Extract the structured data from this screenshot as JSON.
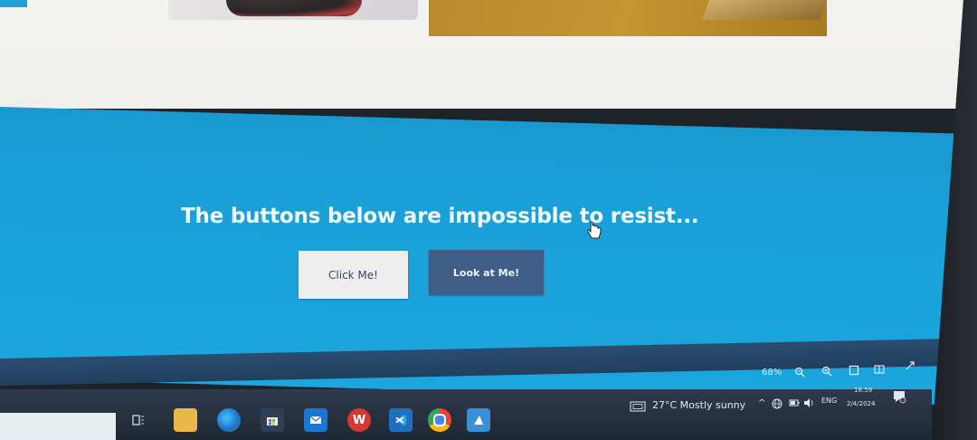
{
  "page": {
    "headline": "The buttons below are impossible to resist...",
    "buttons": [
      {
        "label": "Click Me!"
      },
      {
        "label": "Look at Me!"
      }
    ]
  },
  "statusbar": {
    "zoom": "68%"
  },
  "taskbar": {
    "weather": "27°C  Mostly sunny",
    "language": "ENG",
    "time": "18:59",
    "date": "2/4/2024"
  },
  "icons": {
    "taskview": "task-view-icon",
    "explorer": "file-explorer-icon",
    "edge": "edge-browser-icon",
    "store": "store-icon",
    "mail": "mail-icon",
    "office": "wps-office-icon",
    "vscode": "vscode-icon",
    "chrome": "chrome-icon",
    "app": "pinned-app-icon"
  },
  "colors": {
    "section_blue": "#1ba2da",
    "button_dark": "#3f5d86",
    "button_light": "#eeeeee"
  }
}
